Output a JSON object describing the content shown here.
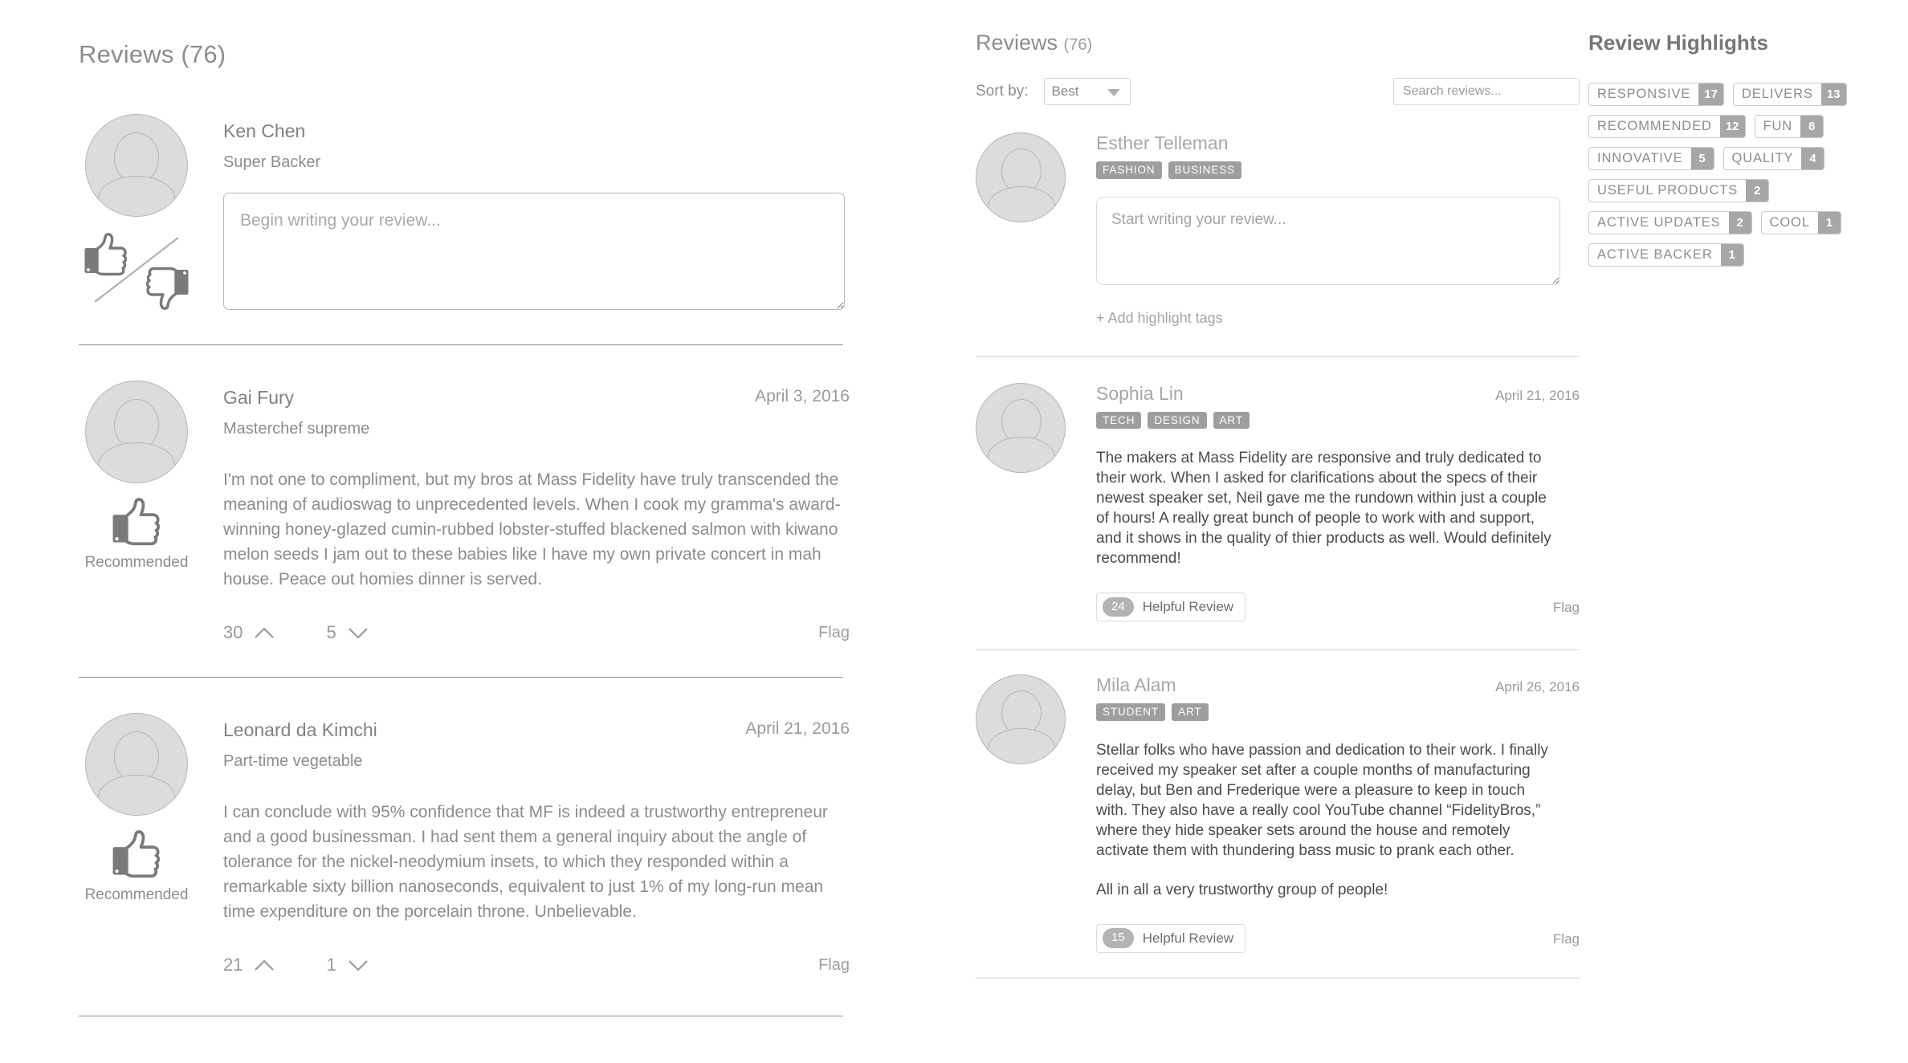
{
  "left": {
    "title": "Reviews (76)",
    "composer": {
      "user_name": "Ken Chen",
      "user_subtitle": "Super Backer",
      "placeholder": "Begin writing your review...",
      "value": ""
    },
    "reviews": [
      {
        "name": "Gai Fury",
        "subtitle": "Masterchef supreme",
        "date": "April 3, 2016",
        "recommend_label": "Recommended",
        "body": "I'm not one to compliment, but my bros at Mass Fidelity have truly transcended the meaning of audioswag to unprecedented levels. When I cook my gramma's award-winning honey-glazed cumin-rubbed lobster-stuffed blackened salmon with kiwano melon seeds I jam out to these babies like I have my own private concert in mah house. Peace out homies dinner is served.",
        "upvotes": "30",
        "downvotes": "5",
        "flag_label": "Flag"
      },
      {
        "name": "Leonard da Kimchi",
        "subtitle": "Part-time vegetable",
        "date": "April 21, 2016",
        "recommend_label": "Recommended",
        "body": "I can conclude with 95% confidence that MF is indeed a trustworthy entrepreneur and a good businessman. I had sent them a general inquiry about the angle of tolerance for the nickel-neodymium insets, to which they responded within a remarkable sixty billion nanoseconds, equivalent to just 1% of my long-run mean time expenditure on the porcelain throne. Unbelievable.",
        "upvotes": "21",
        "downvotes": "1",
        "flag_label": "Flag"
      }
    ]
  },
  "middle": {
    "title": "Reviews",
    "count": "(76)",
    "sort_label": "Sort by:",
    "sort_value": "Best",
    "sort_options": [
      "Best"
    ],
    "search_placeholder": "Search reviews...",
    "search_value": "",
    "composer": {
      "user_name": "Esther Telleman",
      "tags": [
        "FASHION",
        "BUSINESS"
      ],
      "placeholder": "Start writing your review...",
      "value": "",
      "add_tags_label": "+ Add highlight tags"
    },
    "reviews": [
      {
        "name": "Sophia Lin",
        "tags": [
          "TECH",
          "DESIGN",
          "ART"
        ],
        "date": "April 21, 2016",
        "paragraphs": [
          "The makers at Mass Fidelity are responsive and truly dedicated to their work. When I asked for clarifications about the specs of their newest speaker set, Neil gave me the rundown within just a couple of hours! A really great bunch of people to work with and support, and it shows in the quality of thier products as well. Would definitely recommend!"
        ],
        "helpful_count": "24",
        "helpful_label": "Helpful Review",
        "flag_label": "Flag"
      },
      {
        "name": "Mila Alam",
        "tags": [
          "STUDENT",
          "ART"
        ],
        "date": "April 26, 2016",
        "paragraphs": [
          "Stellar folks who have passion and dedication to their work. I finally received my speaker set after a couple months of manufacturing delay, but Ben and Frederique were a pleasure to keep in touch with. They also have a really cool YouTube channel “FidelityBros,” where they hide speaker sets around the house and remotely activate them with thundering bass music to prank each other.",
          "All in all a very trustworthy group of people!"
        ],
        "helpful_count": "15",
        "helpful_label": "Helpful Review",
        "flag_label": "Flag"
      }
    ]
  },
  "right": {
    "title": "Review Highlights",
    "tags": [
      {
        "label": "RESPONSIVE",
        "count": "17"
      },
      {
        "label": "DELIVERS",
        "count": "13"
      },
      {
        "label": "RECOMMENDED",
        "count": "12"
      },
      {
        "label": "FUN",
        "count": "8"
      },
      {
        "label": "INNOVATIVE",
        "count": "5"
      },
      {
        "label": "QUALITY",
        "count": "4"
      },
      {
        "label": "USEFUL PRODUCTS",
        "count": "2"
      },
      {
        "label": "ACTIVE UPDATES",
        "count": "2"
      },
      {
        "label": "COOL",
        "count": "1"
      },
      {
        "label": "ACTIVE BACKER",
        "count": "1"
      }
    ]
  },
  "colors": {
    "text_muted": "#8d8d8d",
    "text_body_left": "#8c8c8c",
    "text_body_mid": "#4b4b4b",
    "tag_bg": "#9e9e9e",
    "avatar_fill": "#dcdcdc",
    "divider_left": "#8f8f8f",
    "divider_mid": "#e6e6e6"
  }
}
